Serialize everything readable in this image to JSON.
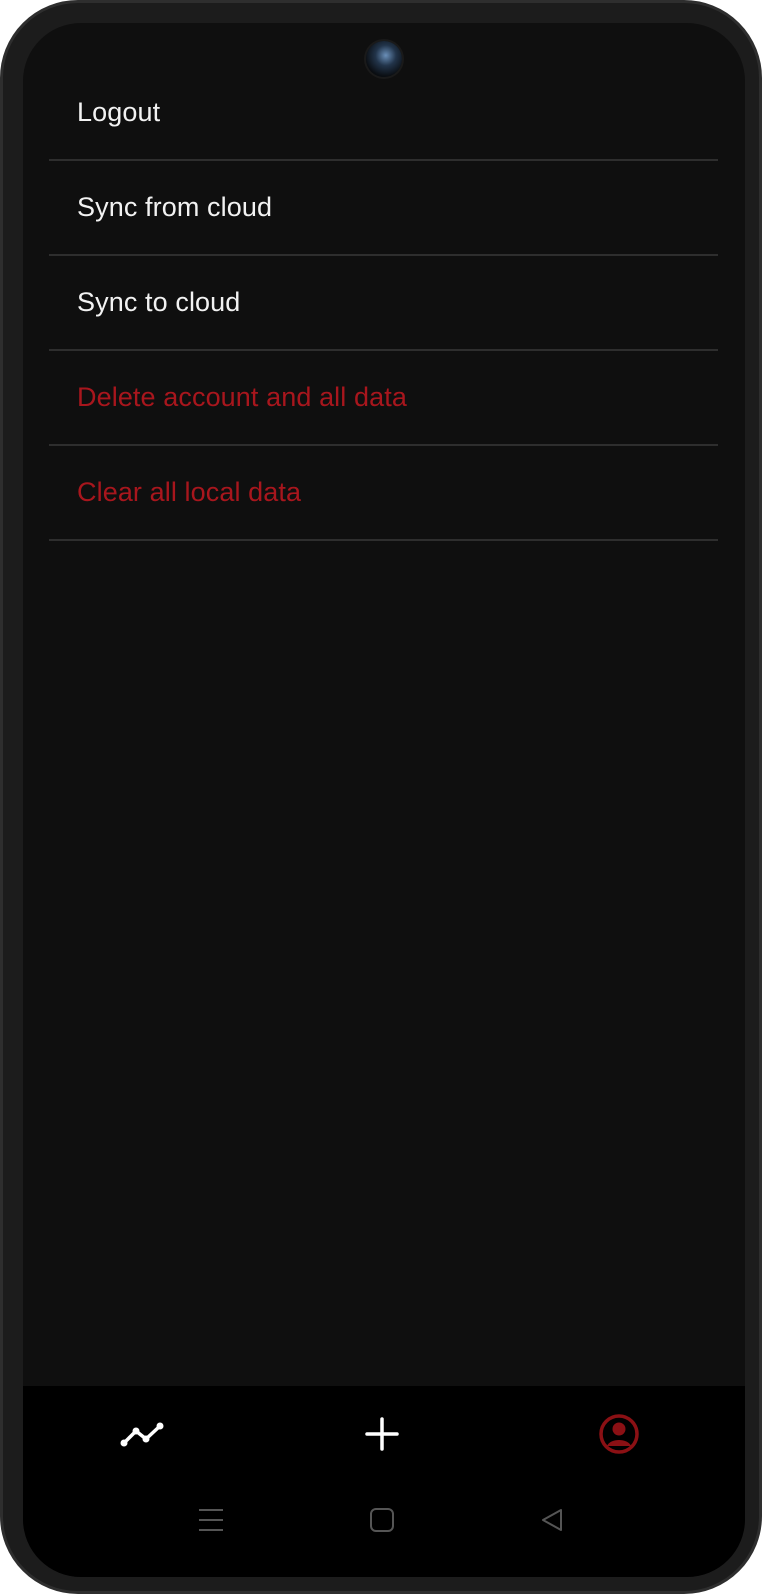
{
  "menu": {
    "items": [
      {
        "label": "Logout",
        "style": "normal"
      },
      {
        "label": "Sync from cloud",
        "style": "normal"
      },
      {
        "label": "Sync to cloud",
        "style": "normal"
      },
      {
        "label": "Delete account and all data",
        "style": "danger"
      },
      {
        "label": "Clear all local data",
        "style": "danger"
      }
    ]
  },
  "bottom_nav": {
    "items": [
      {
        "icon": "trend-line-icon",
        "active": false
      },
      {
        "icon": "plus-icon",
        "active": false
      },
      {
        "icon": "profile-icon",
        "active": true
      }
    ]
  },
  "system_nav": {
    "items": [
      {
        "icon": "recent-apps-icon"
      },
      {
        "icon": "home-icon"
      },
      {
        "icon": "back-icon"
      }
    ]
  },
  "colors": {
    "background": "#0f0f0f",
    "text": "#f2f2f2",
    "danger": "#a8161d",
    "divider": "#2e2e2e",
    "nav_background": "#000000",
    "active_icon": "#8b1014"
  }
}
